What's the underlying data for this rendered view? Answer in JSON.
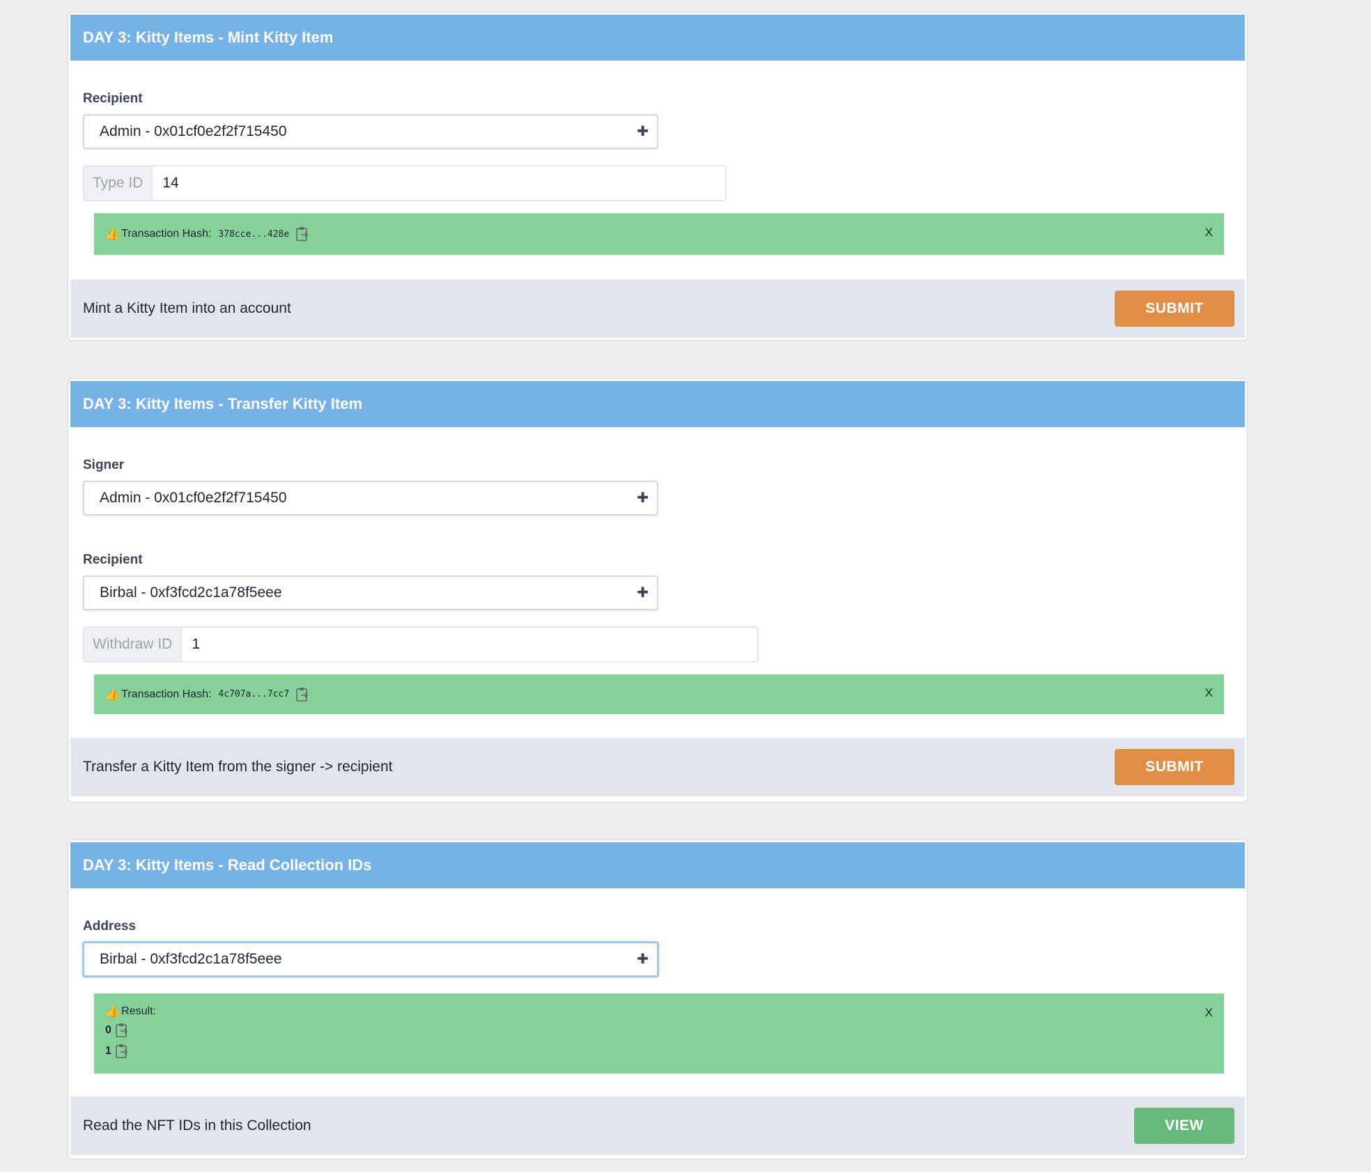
{
  "colors": {
    "header_bg": "#76b2e6",
    "success_bg": "#85d197",
    "submit_bg": "#e08d45",
    "view_bg": "#66b97a",
    "footer_bg": "#e2e6ec"
  },
  "cards": [
    {
      "title": "DAY 3: Kitty Items - Mint Kitty Item",
      "recipient_label": "Recipient",
      "recipient_value": "Admin - 0x01cf0e2f2f715450",
      "typeid_addon": "Type ID",
      "typeid_value": "14",
      "tx_label": "Transaction Hash:",
      "tx_hash": "378cce...428e",
      "close": "X",
      "description": "Mint a Kitty Item into an account",
      "button": "SUBMIT"
    },
    {
      "title": "DAY 3: Kitty Items - Transfer Kitty Item",
      "signer_label": "Signer",
      "signer_value": "Admin - 0x01cf0e2f2f715450",
      "recipient_label": "Recipient",
      "recipient_value": "Birbal - 0xf3fcd2c1a78f5eee",
      "withdraw_addon": "Withdraw ID",
      "withdraw_value": "1",
      "tx_label": "Transaction Hash:",
      "tx_hash": "4c707a...7cc7",
      "close": "X",
      "description": "Transfer a Kitty Item from the signer -> recipient",
      "button": "SUBMIT"
    },
    {
      "title": "DAY 3: Kitty Items - Read Collection IDs",
      "address_label": "Address",
      "address_value": "Birbal - 0xf3fcd2c1a78f5eee",
      "result_label": "Result:",
      "results": [
        "0",
        "1"
      ],
      "close": "X",
      "description": "Read the NFT IDs in this Collection",
      "button": "VIEW"
    }
  ],
  "icons": {
    "dropdown": "plus-icon",
    "like": "thumbs-up-icon",
    "copy": "clipboard-icon"
  }
}
